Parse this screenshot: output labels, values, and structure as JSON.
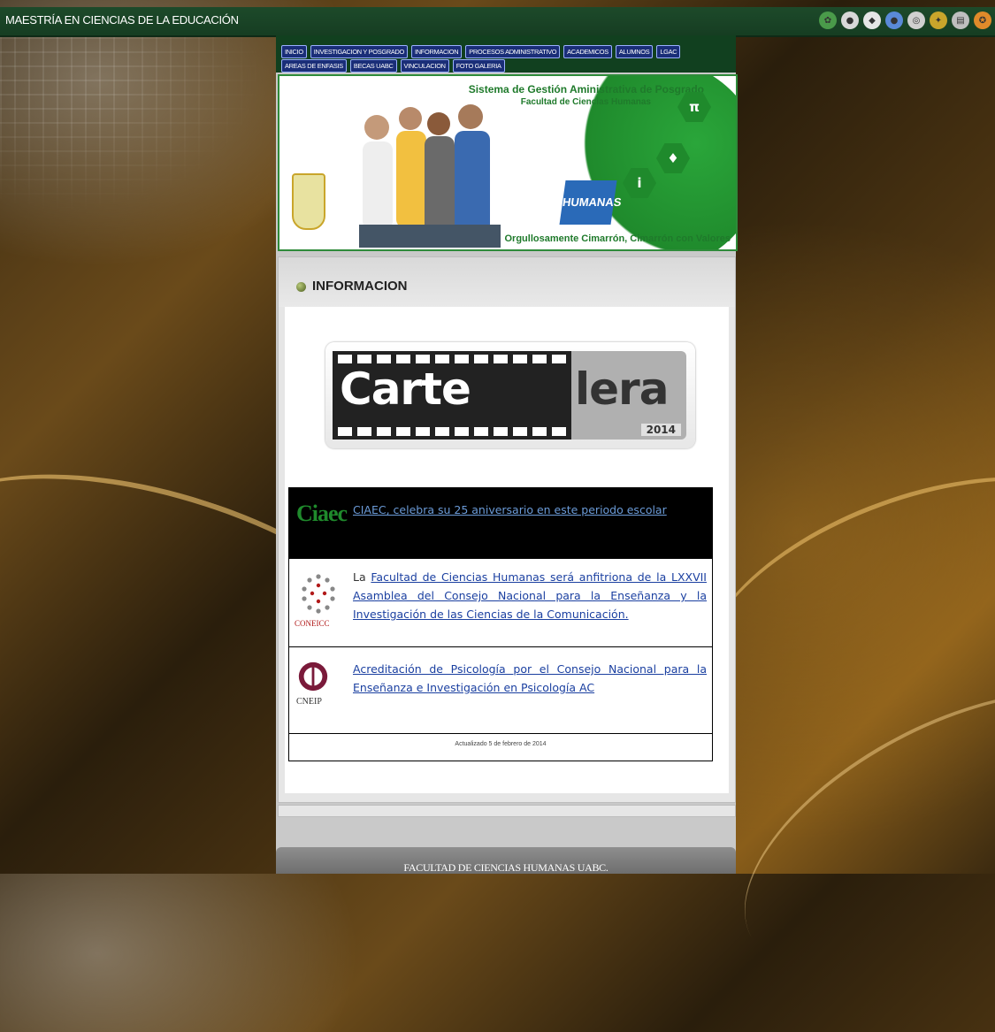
{
  "header": {
    "title": "MAESTRÍA EN CIENCIAS DE LA EDUCACIÓN"
  },
  "top_icons": [
    {
      "name": "uabc-icon",
      "color": "#4a9a4a"
    },
    {
      "name": "circle-icon",
      "color": "#d8d8d8"
    },
    {
      "name": "diamond-icon",
      "color": "#e6e6e6"
    },
    {
      "name": "person-icon",
      "color": "#5a8ad8"
    },
    {
      "name": "globe-icon",
      "color": "#d0d0d0"
    },
    {
      "name": "shield-icon",
      "color": "#c9a52b"
    },
    {
      "name": "book-icon",
      "color": "#bfbfbf"
    },
    {
      "name": "badge-icon",
      "color": "#e08a2a"
    }
  ],
  "nav": {
    "row1": [
      "INICIO",
      "INVESTIGACION Y POSGRADO",
      "INFORMACION",
      "PROCESOS ADMINISTRATIVO",
      "ACADEMICOS",
      "ALUMNOS",
      "LGAC"
    ],
    "row2": [
      "AREAS DE ENFASIS",
      "BECAS UABC",
      "VINCULACION",
      "FOTO GALERIA"
    ]
  },
  "banner": {
    "title": "Sistema de Gestión Aministrativa de Posgrado",
    "subtitle": "Facultad de Ciencias Humanas",
    "slogan": "Orgullosamente Cimarrón, Cimarrón con Valores",
    "badge_text": "HUMANAS"
  },
  "section": {
    "heading": "INFORMACION"
  },
  "cartelera": {
    "part1": "Carte",
    "part2": "lera",
    "year": "2014"
  },
  "news": [
    {
      "logo_text": "Ciaec",
      "prefix": "",
      "link": "CIAEC, celebra su 25 aniversario en este periodo escolar"
    },
    {
      "logo_text": "CONEICC",
      "prefix": "La ",
      "link": "Facultad de Ciencias Humanas será anfitriona de la LXXVII Asamblea del Consejo Nacional para la Enseñanza y la Investigación de las Ciencias de la Comunicación."
    },
    {
      "logo_text": "CNEIP",
      "prefix": "",
      "link": "Acreditación de Psicología por el Consejo Nacional para la Enseñanza e Investigación en Psicología AC"
    }
  ],
  "updated": "Actualizado 5 de febrero de 2014",
  "footer": {
    "text": "FACULTAD DE CIENCIAS HUMANAS UABC."
  },
  "colors": {
    "nav_bg": "#11401f",
    "nav_button": "#1a2e78",
    "brand_green": "#1f8a2c",
    "link": "#1a3fa0"
  }
}
